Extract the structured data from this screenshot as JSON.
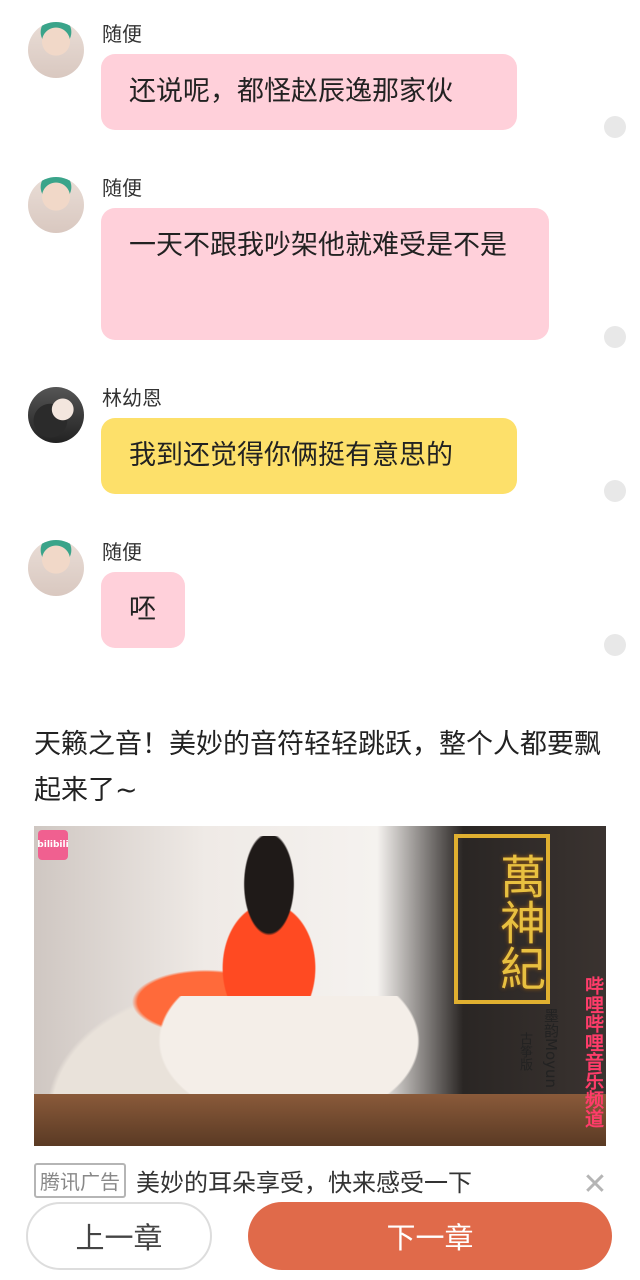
{
  "messages": [
    {
      "name": "随便",
      "text": "还说呢，都怪赵辰逸那家伙"
    },
    {
      "name": "随便",
      "text": "一天不跟我吵架他就难受是不是"
    },
    {
      "name": "林幼恩",
      "text": "我到还觉得你俩挺有意思的"
    },
    {
      "name": "随便",
      "text": "呸"
    }
  ],
  "promo": {
    "text": "天籁之音！美妙的音符轻轻跳跃，整个人都要飘起来了~"
  },
  "ad": {
    "image_title": "萬神紀",
    "side_text": "哔哩哔哩音乐频道",
    "artist": "墨韵Moyun",
    "artist_sub": "古筝版",
    "logo": "bilibili",
    "badge": "腾讯广告",
    "caption": "美妙的耳朵享受，快来感受一下"
  },
  "nav": {
    "prev_label": "上一章",
    "next_label": "下一章"
  },
  "colors": {
    "pink_bubble": "#ffd0da",
    "yellow_bubble": "#fde06a",
    "next_button": "#e06a4a"
  }
}
